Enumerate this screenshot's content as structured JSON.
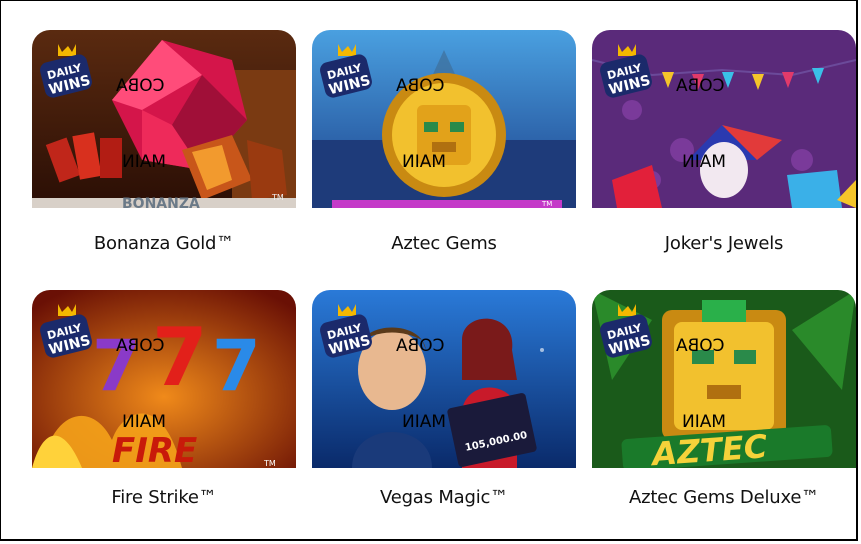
{
  "badge": {
    "line1": "DAILY",
    "line2": "WINS"
  },
  "overlay": {
    "try_label": "COBA",
    "play_label": "MAIN"
  },
  "games": [
    {
      "title": "Bonanza Gold™",
      "art_text": "BONANZA",
      "art_tm": "TM"
    },
    {
      "title": "Aztec Gems",
      "art_text": "",
      "art_tm": "TM"
    },
    {
      "title": "Joker's Jewels",
      "art_text": "",
      "art_tm": ""
    },
    {
      "title": "Fire Strike™",
      "art_text": "FIRE",
      "art_tm": "TM"
    },
    {
      "title": "Vegas Magic™",
      "art_text": "105,000.00",
      "art_tm": ""
    },
    {
      "title": "Aztec Gems Deluxe™",
      "art_text": "AZTEC",
      "art_tm": ""
    }
  ],
  "colors": {
    "background": "#ffffff",
    "title_text": "#111111",
    "badge_blue": "#1b2a6b",
    "badge_gold": "#f5b800"
  }
}
